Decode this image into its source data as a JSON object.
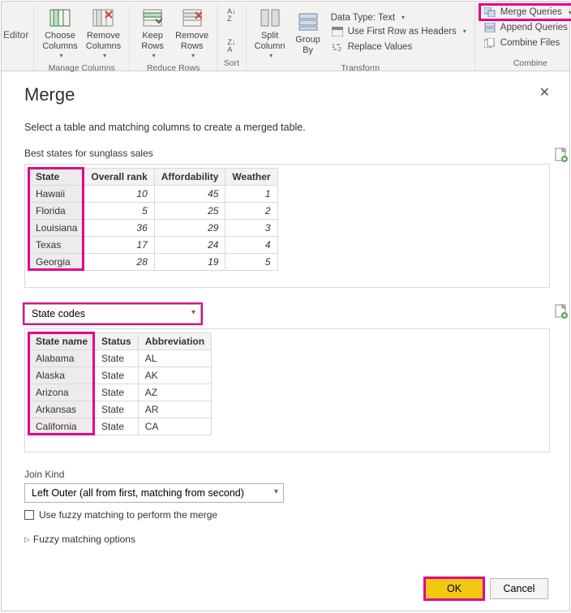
{
  "ribbon": {
    "editor_tag": "Editor",
    "manage_columns": {
      "label": "Manage Columns",
      "choose": "Choose\nColumns",
      "remove": "Remove\nColumns"
    },
    "reduce_rows": {
      "label": "Reduce Rows",
      "keep": "Keep\nRows",
      "remove": "Remove\nRows"
    },
    "sort": {
      "label": "Sort"
    },
    "transform": {
      "label": "Transform",
      "split": "Split\nColumn",
      "group": "Group\nBy",
      "dtype": "Data Type: Text",
      "first_row": "Use First Row as Headers",
      "replace": "Replace Values"
    },
    "combine": {
      "label": "Combine",
      "merge": "Merge Queries",
      "append": "Append Queries",
      "files": "Combine Files"
    }
  },
  "dialog": {
    "title": "Merge",
    "desc": "Select a table and matching columns to create a merged table.",
    "table1_label": "Best states for sunglass sales",
    "table2_select": "State codes",
    "join_label": "Join Kind",
    "join_value": "Left Outer (all from first, matching from second)",
    "fuzzy_check": "Use fuzzy matching to perform the merge",
    "fuzzy_expand": "Fuzzy matching options",
    "ok": "OK",
    "cancel": "Cancel"
  },
  "table1": {
    "headers": [
      "State",
      "Overall rank",
      "Affordability",
      "Weather"
    ],
    "rows": [
      [
        "Hawaii",
        10,
        45,
        1
      ],
      [
        "Florida",
        5,
        25,
        2
      ],
      [
        "Louisiana",
        36,
        29,
        3
      ],
      [
        "Texas",
        17,
        24,
        4
      ],
      [
        "Georgia",
        28,
        19,
        5
      ]
    ]
  },
  "table2": {
    "headers": [
      "State name",
      "Status",
      "Abbreviation"
    ],
    "rows": [
      [
        "Alabama",
        "State",
        "AL"
      ],
      [
        "Alaska",
        "State",
        "AK"
      ],
      [
        "Arizona",
        "State",
        "AZ"
      ],
      [
        "Arkansas",
        "State",
        "AR"
      ],
      [
        "California",
        "State",
        "CA"
      ]
    ]
  }
}
